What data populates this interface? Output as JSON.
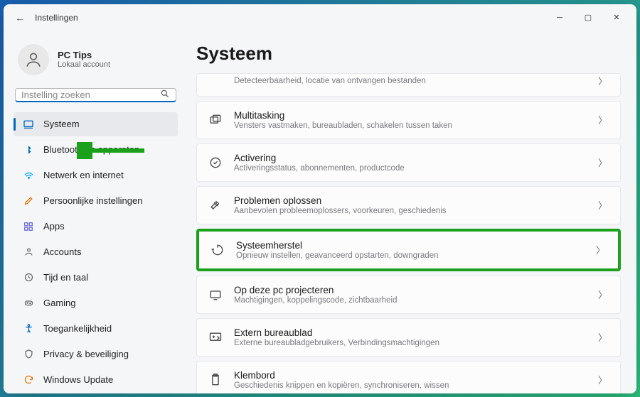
{
  "window": {
    "app_title": "Instellingen"
  },
  "user": {
    "name": "PC Tips",
    "subtitle": "Lokaal account"
  },
  "search": {
    "placeholder": "Instelling zoeken"
  },
  "sidebar": {
    "items": [
      {
        "label": "Systeem"
      },
      {
        "label": "Bluetooth en apparaten"
      },
      {
        "label": "Netwerk en internet"
      },
      {
        "label": "Persoonlijke instellingen"
      },
      {
        "label": "Apps"
      },
      {
        "label": "Accounts"
      },
      {
        "label": "Tijd en taal"
      },
      {
        "label": "Gaming"
      },
      {
        "label": "Toegankelijkheid"
      },
      {
        "label": "Privacy & beveiliging"
      },
      {
        "label": "Windows Update"
      }
    ]
  },
  "page": {
    "title": "Systeem"
  },
  "cards": [
    {
      "title": "",
      "sub": "Detecteerbaarheid, locatie van ontvangen bestanden"
    },
    {
      "title": "Multitasking",
      "sub": "Vensters vastmaken, bureaubladen, schakelen tussen taken"
    },
    {
      "title": "Activering",
      "sub": "Activeringsstatus, abonnementen, productcode"
    },
    {
      "title": "Problemen oplossen",
      "sub": "Aanbevolen probleemoplossers, voorkeuren, geschiedenis"
    },
    {
      "title": "Systeemherstel",
      "sub": "Opnieuw instellen, geavanceerd opstarten, downgraden"
    },
    {
      "title": "Op deze pc projecteren",
      "sub": "Machtigingen, koppelingscode, zichtbaarheid"
    },
    {
      "title": "Extern bureaublad",
      "sub": "Externe bureaubladgebruikers, Verbindingsmachtigingen"
    },
    {
      "title": "Klembord",
      "sub": "Geschiedenis knippen en kopiëren, synchroniseren, wissen"
    }
  ]
}
